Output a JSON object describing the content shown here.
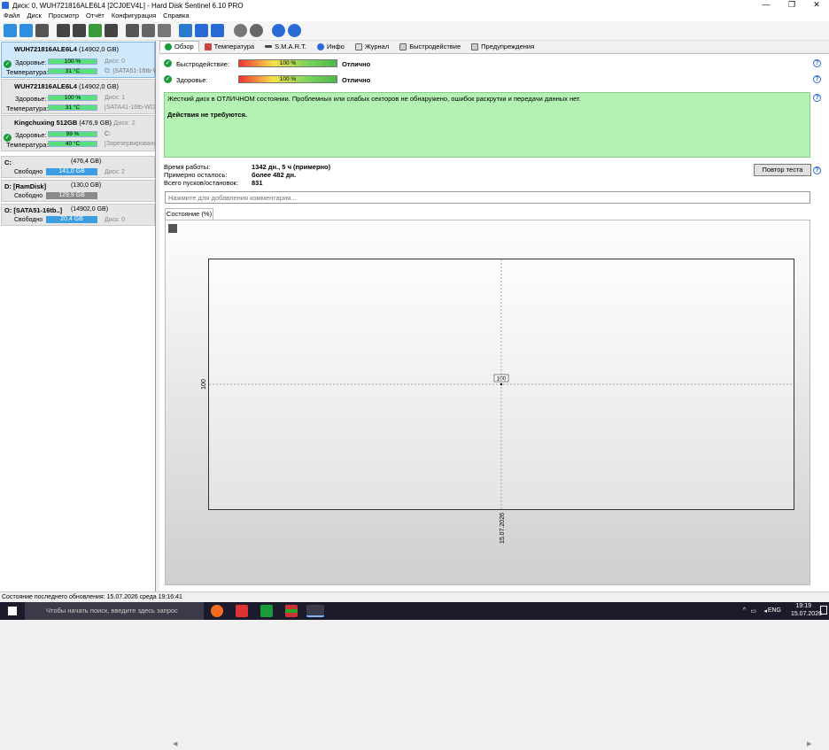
{
  "window": {
    "title": "Диск: 0, WUH721816ALE6L4 [2CJ0EV4L]  -  Hard Disk Sentinel 6.10 PRO",
    "minimize": "—",
    "maximize": "❐",
    "close": "✕"
  },
  "menu": [
    "Файл",
    "Диск",
    "Просмотр",
    "Отчёт",
    "Конфигурация",
    "Справка"
  ],
  "disks": [
    {
      "name": "WUH721816ALE6L4",
      "capacity": "(14902,0 GB)",
      "health_label": "Здоровье:",
      "health": "100 %",
      "health_side": "Диск: 0",
      "temp_label": "Температура:",
      "temp": "31 °C",
      "temp_side": "O: [SATA51-16tb-W"
    },
    {
      "name": "WUH721816ALE6L4",
      "capacity": "(14902,0 GB)",
      "health_label": "Здоровье:",
      "health": "100 %",
      "health_side": "Диск: 1",
      "temp_label": "Температура:",
      "temp": "31 °C",
      "temp_side": "[SATA41-16tb-WD]"
    },
    {
      "name": "Kingchuxing 512GB",
      "capacity": "(476,9 GB)",
      "disk_num": "Диск: 2",
      "health_label": "Здоровье:",
      "health": "99 %",
      "health_side": "C:",
      "temp_label": "Температура:",
      "temp": "40 °C",
      "temp_side": "[Зарезервировано"
    }
  ],
  "volumes": [
    {
      "name": "C:",
      "capacity": "(476,4 GB)",
      "free_label": "Свободно",
      "free": "141,0 GB",
      "disk": "Диск: 2"
    },
    {
      "name": "D: [RamDisk]",
      "capacity": "(130,0 GB)",
      "free_label": "Свободно",
      "free": "129,9 GB",
      "disk": ""
    },
    {
      "name": "O: [SATA51-16tb..]",
      "capacity": "(14902,0 GB)",
      "free_label": "Свободно",
      "free": "20,4 GB",
      "disk": "Диск: 0"
    }
  ],
  "tabs": [
    "Обзор",
    "Температура",
    "S.M.A.R.T.",
    "Инфо",
    "Журнал",
    "Быстродействие",
    "Предупреждения"
  ],
  "overview": {
    "performance_label": "Быстродействие:",
    "performance": "100 %",
    "performance_pct": 100,
    "performance_status": "Отлично",
    "health_label": "Здоровье:",
    "health": "100 %",
    "health_pct": 100,
    "health_status": "Отлично",
    "status_text": "Жесткий диск в ОТЛИЧНОМ состоянии. Проблемных или слабых секторов не обнаружено, ошибок раскрутки и передачи данных нет.",
    "action_text": "Действия не требуются.",
    "uptime_label": "Время работы:",
    "uptime": "1342 дн., 5 ч (примерно)",
    "remaining_label": "Примерно осталось:",
    "remaining": "более 482 дн.",
    "starts_label": "Всего пусков/остановок:",
    "starts": "831",
    "retest_button": "Повтор теста",
    "comment_placeholder": "Нажмите для добавления комментария..."
  },
  "subtab": "Состояние (%)",
  "chart_data": {
    "type": "line",
    "title": "",
    "xlabel": "",
    "ylabel": "",
    "x": [
      "15.07.2026"
    ],
    "series": [
      {
        "values": [
          100
        ]
      }
    ],
    "y_tick_labels": [
      "100"
    ],
    "data_labels": [
      "100"
    ],
    "grid": true
  },
  "statusbar": "Состояние последнего обновления: 15.07.2026 среда 19:16:41",
  "taskbar": {
    "search_placeholder": "Чтобы начать поиск, введите здесь запрос",
    "lang": "ENG",
    "time": "19:19",
    "date": "15.07.2026"
  }
}
